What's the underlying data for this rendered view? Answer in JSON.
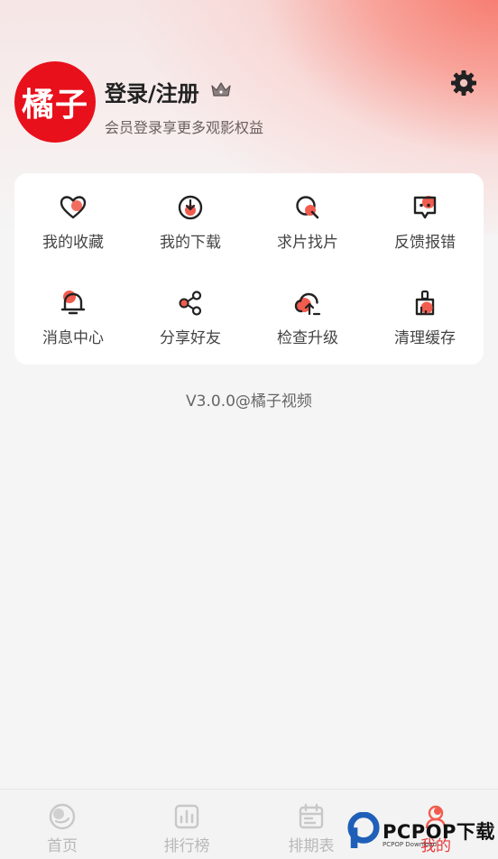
{
  "profile": {
    "avatar_text": "橘子",
    "login_label": "登录/注册",
    "subtitle": "会员登录享更多观影权益"
  },
  "menu": {
    "items": [
      {
        "label": "我的收藏",
        "icon": "heart-icon"
      },
      {
        "label": "我的下载",
        "icon": "download-icon"
      },
      {
        "label": "求片找片",
        "icon": "search-icon"
      },
      {
        "label": "反馈报错",
        "icon": "feedback-icon"
      },
      {
        "label": "消息中心",
        "icon": "bell-icon"
      },
      {
        "label": "分享好友",
        "icon": "share-icon"
      },
      {
        "label": "检查升级",
        "icon": "upgrade-icon"
      },
      {
        "label": "清理缓存",
        "icon": "broom-icon"
      }
    ]
  },
  "version": "V3.0.0@橘子视频",
  "tabs": [
    {
      "label": "首页",
      "icon": "home-icon",
      "active": false
    },
    {
      "label": "排行榜",
      "icon": "ranking-icon",
      "active": false
    },
    {
      "label": "排期表",
      "icon": "calendar-icon",
      "active": false
    },
    {
      "label": "我的",
      "icon": "profile-icon",
      "active": true
    }
  ],
  "watermark": {
    "brand": "PCPOP下载",
    "sub": "PCPOP Download"
  },
  "colors": {
    "accent": "#e8393a",
    "avatar_bg": "#e8101b",
    "icon_accent": "#f25c4f"
  }
}
